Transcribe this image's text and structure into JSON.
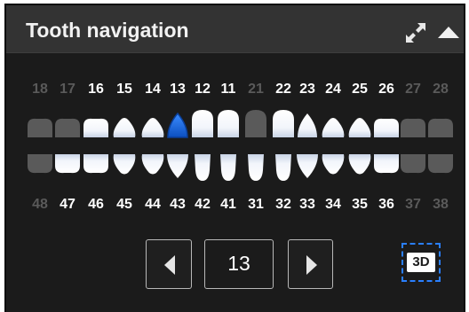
{
  "panel": {
    "title": "Tooth navigation",
    "icons": {
      "expand": "expand-icon",
      "collapse": "chevron-up-icon"
    }
  },
  "upper": {
    "numbers": [
      "18",
      "17",
      "16",
      "15",
      "14",
      "13",
      "12",
      "11",
      "21",
      "22",
      "23",
      "24",
      "25",
      "26",
      "27",
      "28"
    ],
    "available": [
      false,
      false,
      true,
      true,
      true,
      true,
      true,
      true,
      false,
      true,
      true,
      true,
      true,
      true,
      false,
      false
    ]
  },
  "lower": {
    "numbers": [
      "48",
      "47",
      "46",
      "45",
      "44",
      "43",
      "42",
      "41",
      "31",
      "32",
      "33",
      "34",
      "35",
      "36",
      "37",
      "38"
    ],
    "available": [
      false,
      true,
      true,
      true,
      true,
      true,
      true,
      true,
      true,
      true,
      true,
      true,
      true,
      true,
      false,
      false
    ]
  },
  "selected_tooth": "13",
  "navigation": {
    "current_value": "13",
    "prev_icon": "triangle-left-icon",
    "next_icon": "triangle-right-icon"
  },
  "view_button": {
    "label": "3D"
  },
  "colors": {
    "selected": "#1a6fe0",
    "accent": "#2a7fff",
    "unavailable": "#5a5a5a",
    "available": "#ffffff"
  }
}
